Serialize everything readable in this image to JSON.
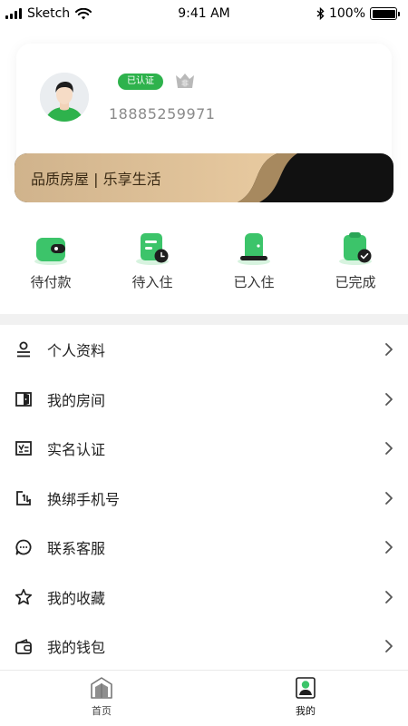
{
  "status_bar": {
    "carrier": "Sketch",
    "time": "9:41 AM",
    "battery": "100%"
  },
  "profile": {
    "verified_label": "已认证",
    "vip_label": "非",
    "phone": "18885259971"
  },
  "banner": {
    "text": "品质房屋 | 乐享生活"
  },
  "orders": [
    {
      "label": "待付款",
      "icon": "wallet-icon"
    },
    {
      "label": "待入住",
      "icon": "pending-checkin-icon"
    },
    {
      "label": "已入住",
      "icon": "checked-in-icon"
    },
    {
      "label": "已完成",
      "icon": "completed-icon"
    }
  ],
  "menu": [
    {
      "label": "个人资料",
      "icon": "profile-icon"
    },
    {
      "label": "我的房间",
      "icon": "room-door-icon"
    },
    {
      "label": "实名认证",
      "icon": "id-card-icon"
    },
    {
      "label": "换绑手机号",
      "icon": "phone-swap-icon"
    },
    {
      "label": "联系客服",
      "icon": "chat-bubble-icon"
    },
    {
      "label": "我的收藏",
      "icon": "star-icon"
    },
    {
      "label": "我的钱包",
      "icon": "wallet-outline-icon"
    }
  ],
  "tabs": [
    {
      "label": "首页",
      "icon": "home-icon"
    },
    {
      "label": "我的",
      "icon": "user-tab-icon"
    }
  ],
  "colors": {
    "accent_green": "#2eb24c",
    "icon_green": "#3cc46a",
    "banner_gold": "#d9b88a",
    "banner_dark": "#111111"
  }
}
